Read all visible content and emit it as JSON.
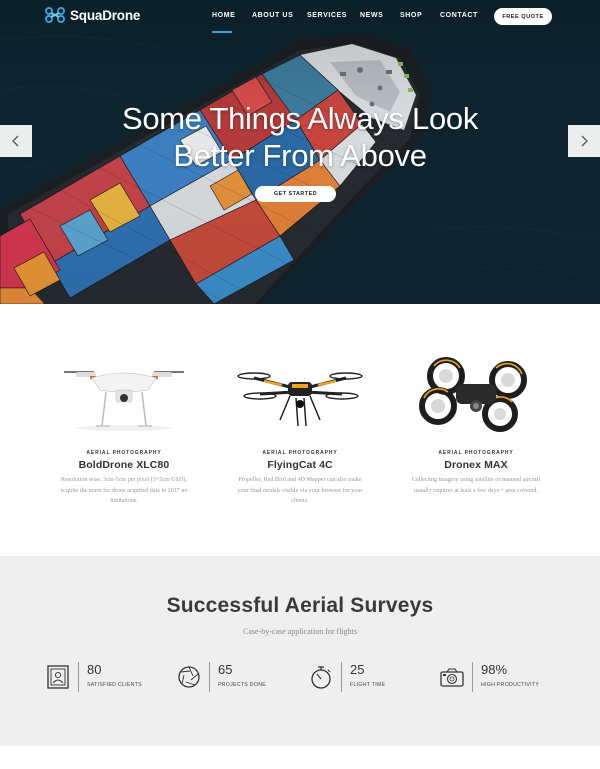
{
  "brand": {
    "name": "SquaDrone",
    "accent": "#3aa0d6"
  },
  "nav": {
    "items": [
      {
        "label": "HOME",
        "active": true
      },
      {
        "label": "ABOUT US"
      },
      {
        "label": "SERVICES"
      },
      {
        "label": "NEWS"
      },
      {
        "label": "SHOP"
      },
      {
        "label": "CONTACT"
      }
    ],
    "cta_label": "FREE QUOTE"
  },
  "hero": {
    "title_line1": "Some Things Always Look",
    "title_line2": "Better From Above",
    "button_label": "GET STARTED",
    "prev_icon": "chevron-left-icon",
    "next_icon": "chevron-right-icon"
  },
  "products": [
    {
      "category": "AERIAL PHOTOGRAPHY",
      "name": "BoldDrone XLC80",
      "description": "Resolution wise, 3cm-5cm per pixel (3+5cm GSD), is quite the norm for drone acquired data in 2017 no limitations."
    },
    {
      "category": "AERIAL PHOTOGRAPHY",
      "name": "FlyingCat 4C",
      "description": "Propeller, Red Bird and 4D Mapper can also make your final models visible via your browser for your clients."
    },
    {
      "category": "AERIAL PHOTOGRAPHY",
      "name": "Dronex MAX",
      "description": "Collecting imagery using satellite or manned aircraft usually requires at least a few days + area covered."
    }
  ],
  "stats": {
    "title": "Successful Aerial Surveys",
    "subtitle": "Case-by-case application for flights",
    "items": [
      {
        "value": "80",
        "label": "SATISFIED CLIENTS",
        "icon": "portrait-icon"
      },
      {
        "value": "65",
        "label": "PROJECTS DONE",
        "icon": "aperture-icon"
      },
      {
        "value": "25",
        "label": "FLIGHT TIME",
        "icon": "stopwatch-icon"
      },
      {
        "value": "98%",
        "label": "HIGH PRODUCTIVITY",
        "icon": "camera-icon"
      }
    ]
  }
}
